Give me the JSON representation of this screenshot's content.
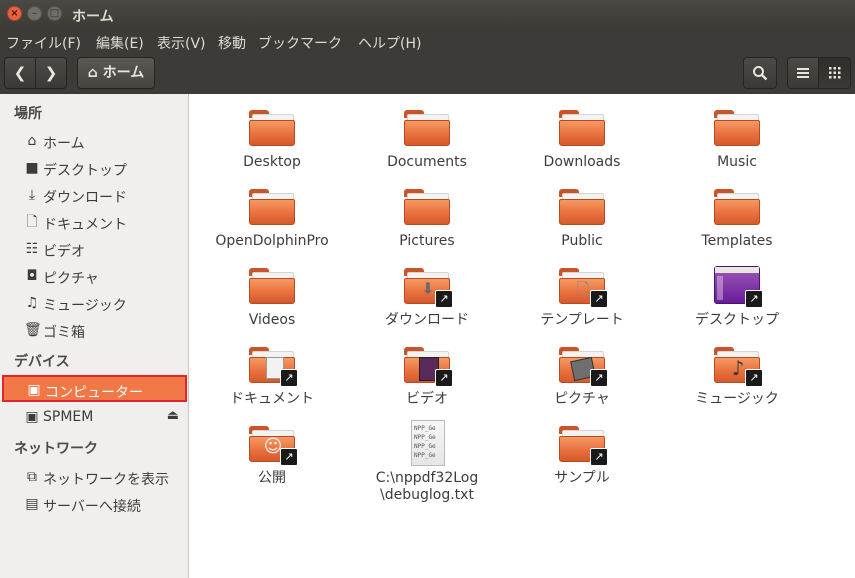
{
  "window": {
    "title": "ホーム"
  },
  "menu": [
    "ファイル(F)",
    "編集(E)",
    "表示(V)",
    "移動",
    "ブックマーク",
    "ヘルプ(H)"
  ],
  "toolbar": {
    "path_label": "ホーム"
  },
  "sidebar": {
    "sections": [
      {
        "header": "場所",
        "items": [
          {
            "label": "ホーム",
            "icon": "home-icon"
          },
          {
            "label": "デスクトップ",
            "icon": "folder-icon"
          },
          {
            "label": "ダウンロード",
            "icon": "download-icon"
          },
          {
            "label": "ドキュメント",
            "icon": "document-icon"
          },
          {
            "label": "ビデオ",
            "icon": "film-icon"
          },
          {
            "label": "ピクチャ",
            "icon": "camera-icon"
          },
          {
            "label": "ミュージック",
            "icon": "music-icon"
          },
          {
            "label": "ゴミ箱",
            "icon": "trash-icon"
          }
        ]
      },
      {
        "header": "デバイス",
        "items": [
          {
            "label": "コンピューター",
            "icon": "drive-icon",
            "selected": true
          },
          {
            "label": "SPMEM",
            "icon": "drive-icon",
            "eject": true
          }
        ]
      },
      {
        "header": "ネットワーク",
        "items": [
          {
            "label": "ネットワークを表示",
            "icon": "network-icon"
          },
          {
            "label": "サーバーへ接続",
            "icon": "server-icon"
          }
        ]
      }
    ]
  },
  "files": [
    {
      "name": "Desktop",
      "kind": "folder"
    },
    {
      "name": "Documents",
      "kind": "folder"
    },
    {
      "name": "Downloads",
      "kind": "folder"
    },
    {
      "name": "Music",
      "kind": "folder"
    },
    {
      "name": "OpenDolphinPro",
      "kind": "folder"
    },
    {
      "name": "Pictures",
      "kind": "folder"
    },
    {
      "name": "Public",
      "kind": "folder"
    },
    {
      "name": "Templates",
      "kind": "folder"
    },
    {
      "name": "Videos",
      "kind": "folder"
    },
    {
      "name": "ダウンロード",
      "kind": "folder-link",
      "overlay": "download-icon"
    },
    {
      "name": "テンプレート",
      "kind": "folder-link",
      "overlay": "template-icon"
    },
    {
      "name": "デスクトップ",
      "kind": "desktop-link"
    },
    {
      "name": "ドキュメント",
      "kind": "folder-link",
      "overlay": "document-icon"
    },
    {
      "name": "ビデオ",
      "kind": "folder-link",
      "overlay": "film-icon"
    },
    {
      "name": "ピクチャ",
      "kind": "folder-link",
      "overlay": "picture-icon"
    },
    {
      "name": "ミュージック",
      "kind": "folder-link",
      "overlay": "music-icon"
    },
    {
      "name": "公開",
      "kind": "folder-link",
      "overlay": "person-icon"
    },
    {
      "name": "C:\\nppdf32Log\n\\debuglog.txt",
      "kind": "text-file",
      "preview": [
        "NPP_Ge",
        "NPP_Ge",
        "NPP_Ge",
        "NPP_Ge"
      ]
    },
    {
      "name": "サンプル",
      "kind": "folder-link",
      "overlay": "none"
    }
  ],
  "colors": {
    "accent": "#f07746",
    "folder": "#e9703f",
    "chrome": "#3c3b37"
  }
}
